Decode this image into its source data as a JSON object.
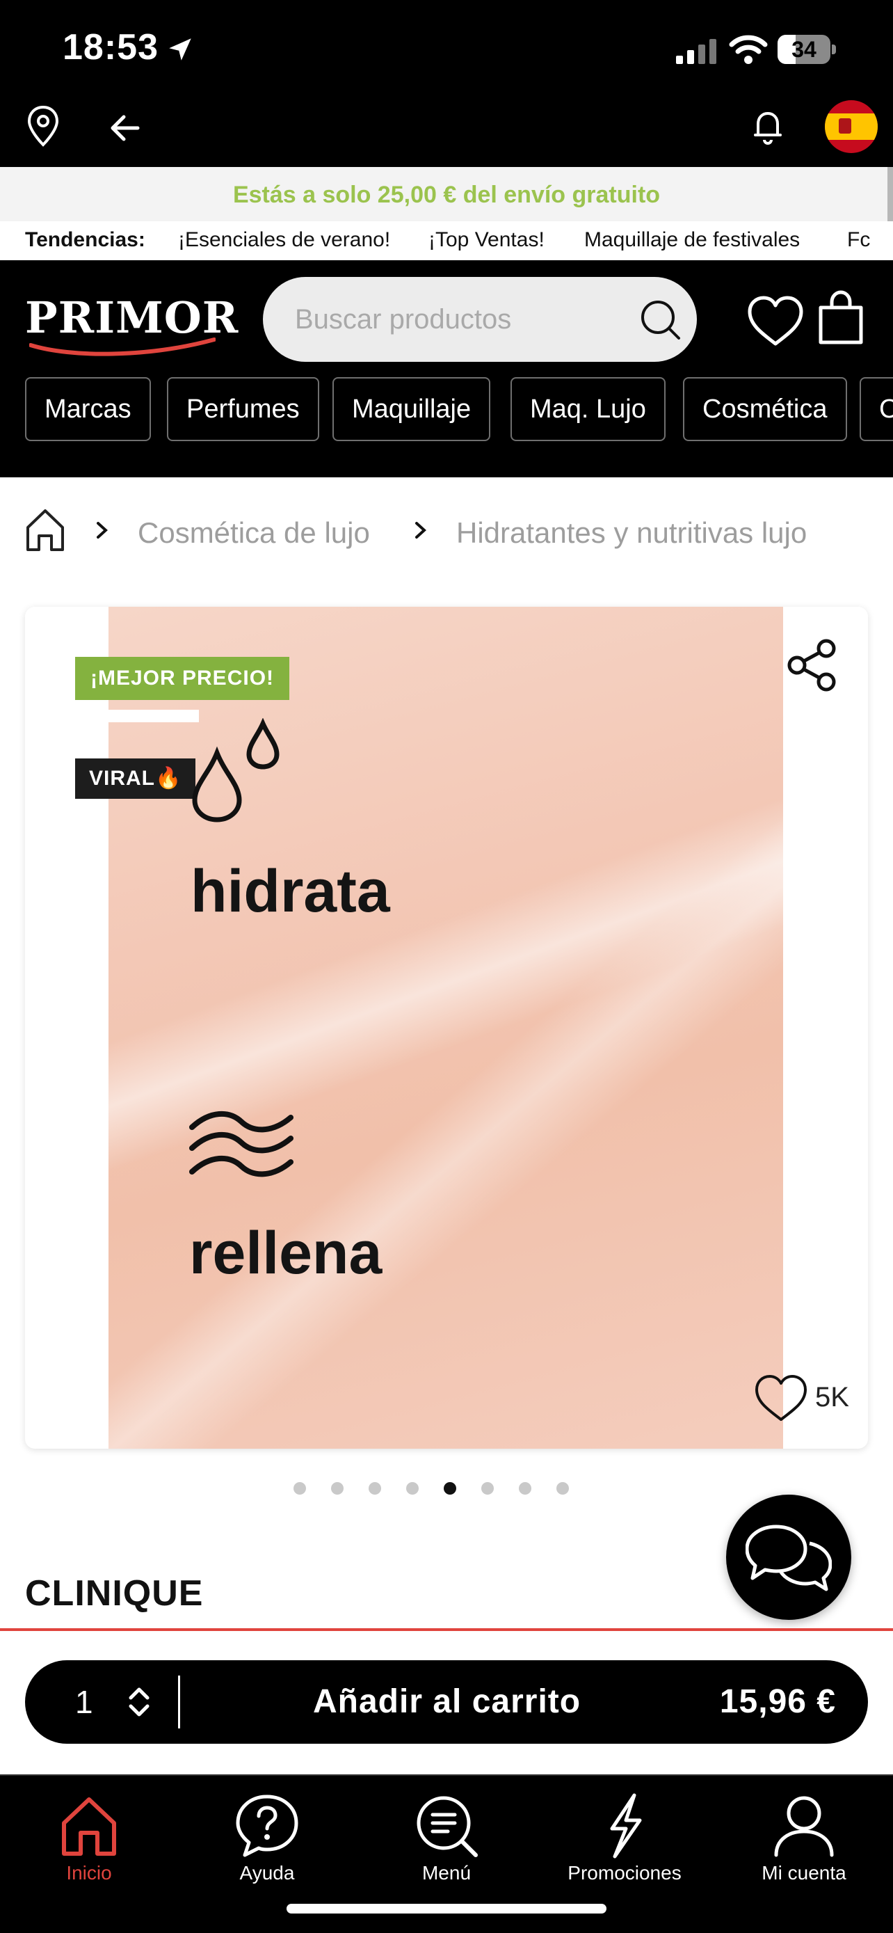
{
  "status_bar": {
    "time": "18:53",
    "battery": "34",
    "battery_level": 0.34
  },
  "promo": {
    "free_shipping_text": "Estás a solo 25,00 € del envío gratuito"
  },
  "trends": {
    "label": "Tendencias:",
    "items": [
      "¡Esenciales de verano!",
      "¡Top Ventas!",
      "Maquillaje de festivales",
      "Fc"
    ]
  },
  "header": {
    "logo_text": "PRIMOR",
    "search_placeholder": "Buscar productos"
  },
  "categories": [
    "Marcas",
    "Perfumes",
    "Maquillaje",
    "Maq. Lujo",
    "Cosmética",
    "C"
  ],
  "breadcrumb": {
    "items": [
      "Cosmética de lujo",
      "Hidratantes y nutritivas lujo"
    ]
  },
  "product_card": {
    "badge_best_price": "¡MEJOR PRECIO!",
    "badge_viral": "VIRAL🔥",
    "image_word_1": "hidrata",
    "image_word_2": "rellena",
    "likes": "5K",
    "carousel": {
      "total": 8,
      "active_index": 4
    }
  },
  "product": {
    "brand": "CLINIQUE"
  },
  "cart": {
    "quantity": "1",
    "add_label": "Añadir al carrito",
    "price": "15,96 €"
  },
  "bottom_nav": [
    {
      "label": "Inicio",
      "icon": "home-icon",
      "active": true
    },
    {
      "label": "Ayuda",
      "icon": "help-icon",
      "active": false
    },
    {
      "label": "Menú",
      "icon": "menu-search-icon",
      "active": false
    },
    {
      "label": "Promociones",
      "icon": "lightning-icon",
      "active": false
    },
    {
      "label": "Mi cuenta",
      "icon": "user-icon",
      "active": false
    }
  ],
  "colors": {
    "accent_green": "#84b23f",
    "promo_green": "#9bc34e",
    "active_red": "#e0443d",
    "dark": "#000000"
  }
}
